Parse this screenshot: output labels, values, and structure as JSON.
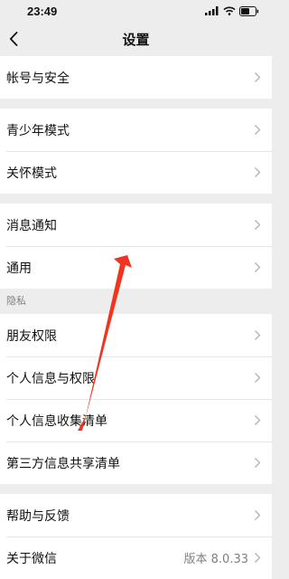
{
  "status_bar": {
    "time": "23:49"
  },
  "header": {
    "title": "设置"
  },
  "groups": [
    {
      "items": [
        {
          "label": "帐号与安全"
        }
      ]
    },
    {
      "items": [
        {
          "label": "青少年模式"
        },
        {
          "label": "关怀模式"
        }
      ]
    },
    {
      "items": [
        {
          "label": "消息通知"
        },
        {
          "label": "通用"
        }
      ]
    },
    {
      "header": "隐私",
      "items": [
        {
          "label": "朋友权限"
        },
        {
          "label": "个人信息与权限"
        },
        {
          "label": "个人信息收集清单"
        },
        {
          "label": "第三方信息共享清单"
        }
      ]
    },
    {
      "items": [
        {
          "label": "帮助与反馈"
        },
        {
          "label": "关于微信",
          "value": "版本 8.0.33"
        }
      ]
    }
  ],
  "colors": {
    "background": "#ededed",
    "row_background": "#ffffff",
    "annotation_arrow": "#f2341e"
  },
  "icons": [
    "back-chevron-icon",
    "signal-icon",
    "wifi-icon",
    "battery-icon",
    "chevron-right-icon"
  ]
}
